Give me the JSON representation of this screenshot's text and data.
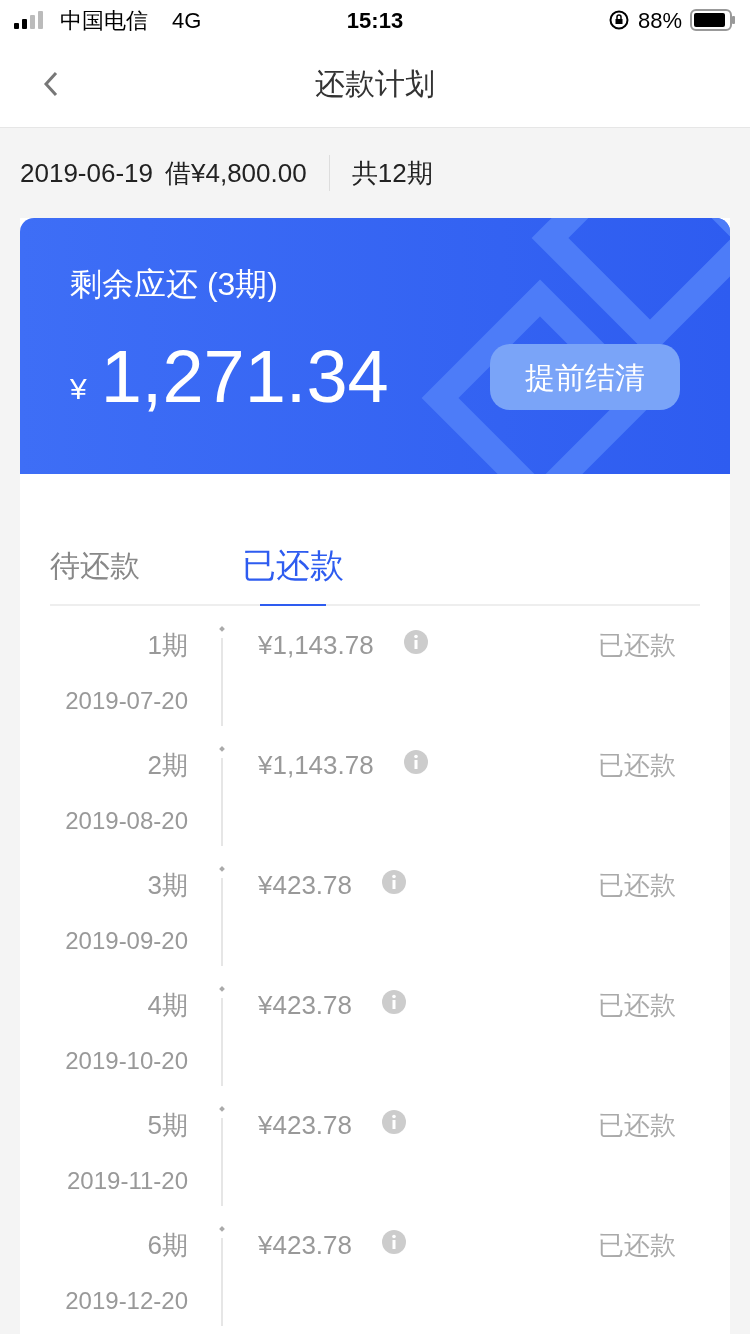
{
  "status_bar": {
    "carrier": "中国电信",
    "network": "4G",
    "time": "15:13",
    "battery": "88%"
  },
  "nav": {
    "title": "还款计划"
  },
  "summary": {
    "date": "2019-06-19",
    "loan": "借¥4,800.00",
    "periods": "共12期"
  },
  "card": {
    "label": "剩余应还 (3期)",
    "currency": "¥",
    "amount": "1,271.34",
    "button": "提前结清"
  },
  "tabs": [
    {
      "label": "待还款",
      "selected": false
    },
    {
      "label": "已还款",
      "selected": true
    }
  ],
  "rows": [
    {
      "period": "1期",
      "date": "2019-07-20",
      "amount": "¥1,143.78",
      "status": "已还款"
    },
    {
      "period": "2期",
      "date": "2019-08-20",
      "amount": "¥1,143.78",
      "status": "已还款"
    },
    {
      "period": "3期",
      "date": "2019-09-20",
      "amount": "¥423.78",
      "status": "已还款"
    },
    {
      "period": "4期",
      "date": "2019-10-20",
      "amount": "¥423.78",
      "status": "已还款"
    },
    {
      "period": "5期",
      "date": "2019-11-20",
      "amount": "¥423.78",
      "status": "已还款"
    },
    {
      "period": "6期",
      "date": "2019-12-20",
      "amount": "¥423.78",
      "status": "已还款"
    }
  ]
}
